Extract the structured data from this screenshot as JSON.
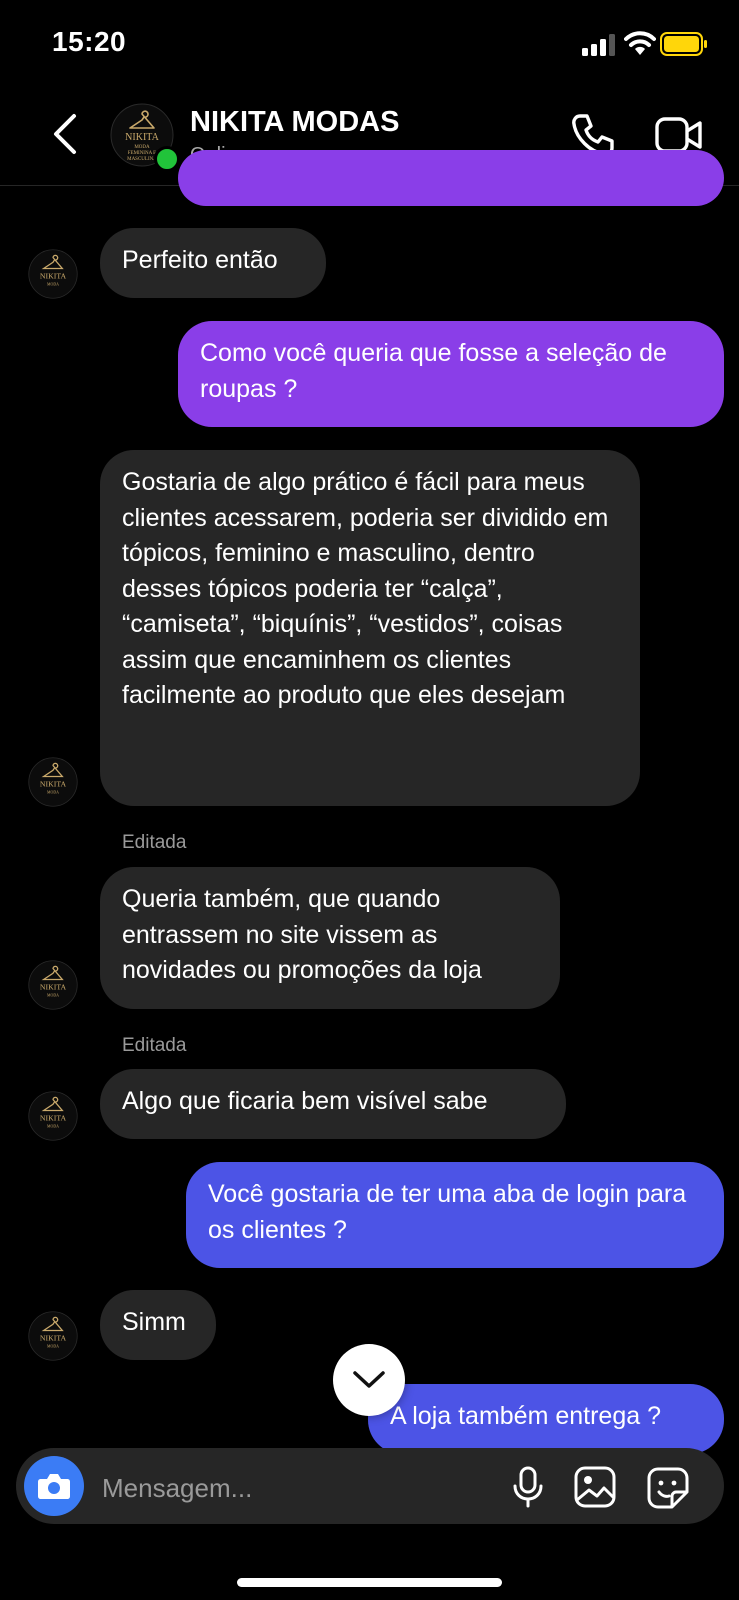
{
  "status_bar": {
    "time": "15:20"
  },
  "header": {
    "contact_name": "NIKITA MODAS",
    "contact_status": "Online agora",
    "avatar_logo_text": "NIKITA",
    "avatar_logo_subtext": "MODA FEMININA E MASCULINA"
  },
  "messages": [
    {
      "side": "out",
      "text": ""
    },
    {
      "side": "in",
      "text": "Perfeito então"
    },
    {
      "side": "out",
      "text": "Como você queria que fosse a seleção de roupas ?"
    },
    {
      "side": "in",
      "text": "Gostaria de algo prático é fácil para meus clientes acessarem, poderia ser dividido em tópicos, feminino e masculino, dentro desses tópicos poderia ter “calça”, “camiseta”, “biquínis”, “vestidos”, coisas assim que encaminhem os clientes facilmente ao produto que eles desejam"
    },
    {
      "side": "in",
      "edited_label": "Editada",
      "text": "Queria também, que quando entrassem no site vissem as novidades ou promoções da loja"
    },
    {
      "side": "in",
      "edited_label": "Editada",
      "text": "Algo que ficaria bem visível sabe"
    },
    {
      "side": "out",
      "text": "Você gostaria de ter uma aba de login para os clientes ?"
    },
    {
      "side": "in",
      "text": "Simm"
    },
    {
      "side": "out",
      "text": "A loja também entrega ?"
    }
  ],
  "composer": {
    "placeholder": "Mensagem..."
  },
  "icons": {
    "back": "chevron-left-icon",
    "call": "phone-icon",
    "video": "video-camera-icon",
    "scroll": "chevron-down-icon",
    "camera": "camera-icon",
    "mic": "microphone-icon",
    "gallery": "image-icon",
    "sticker": "sticker-icon"
  },
  "colors": {
    "background": "#000000",
    "incoming_bubble": "#262626",
    "outgoing_purple": "#8a3ee8",
    "outgoing_blue": "#4c54e6",
    "online": "#21c33a",
    "camera_button": "#3b7cf5",
    "battery": "#ffd60a"
  }
}
